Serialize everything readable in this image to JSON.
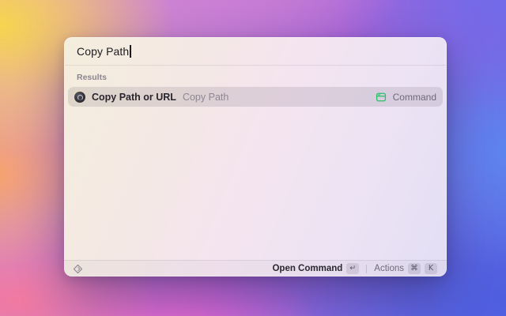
{
  "window": {
    "search": {
      "value": "Copy Path"
    },
    "results_section": {
      "label": "Results"
    },
    "results": [
      {
        "title": "Copy Path or URL",
        "subtitle": "Copy Path",
        "type_label": "Command",
        "icon": "copy-path-extension-icon",
        "type_icon": "command-window-icon",
        "selected": true
      }
    ],
    "footer": {
      "logo_icon": "raycast-logo-icon",
      "primary_action": {
        "label": "Open Command",
        "key": "↵"
      },
      "secondary_action": {
        "label": "Actions",
        "keys": [
          "⌘",
          "K"
        ]
      }
    }
  },
  "colors": {
    "command_icon_green": "#2cbf69",
    "selection_tint": "rgba(96,80,100,0.15)",
    "window_tint_left": "#f4eedd",
    "window_tint_right": "#e3def5",
    "desktop_yellow": "#f6d54e",
    "desktop_orange": "#f7a469",
    "desktop_pink": "#f279a0",
    "desktop_magenta": "#e767cd",
    "desktop_violet": "#6f6aeb",
    "desktop_blue": "#4e5ede"
  }
}
